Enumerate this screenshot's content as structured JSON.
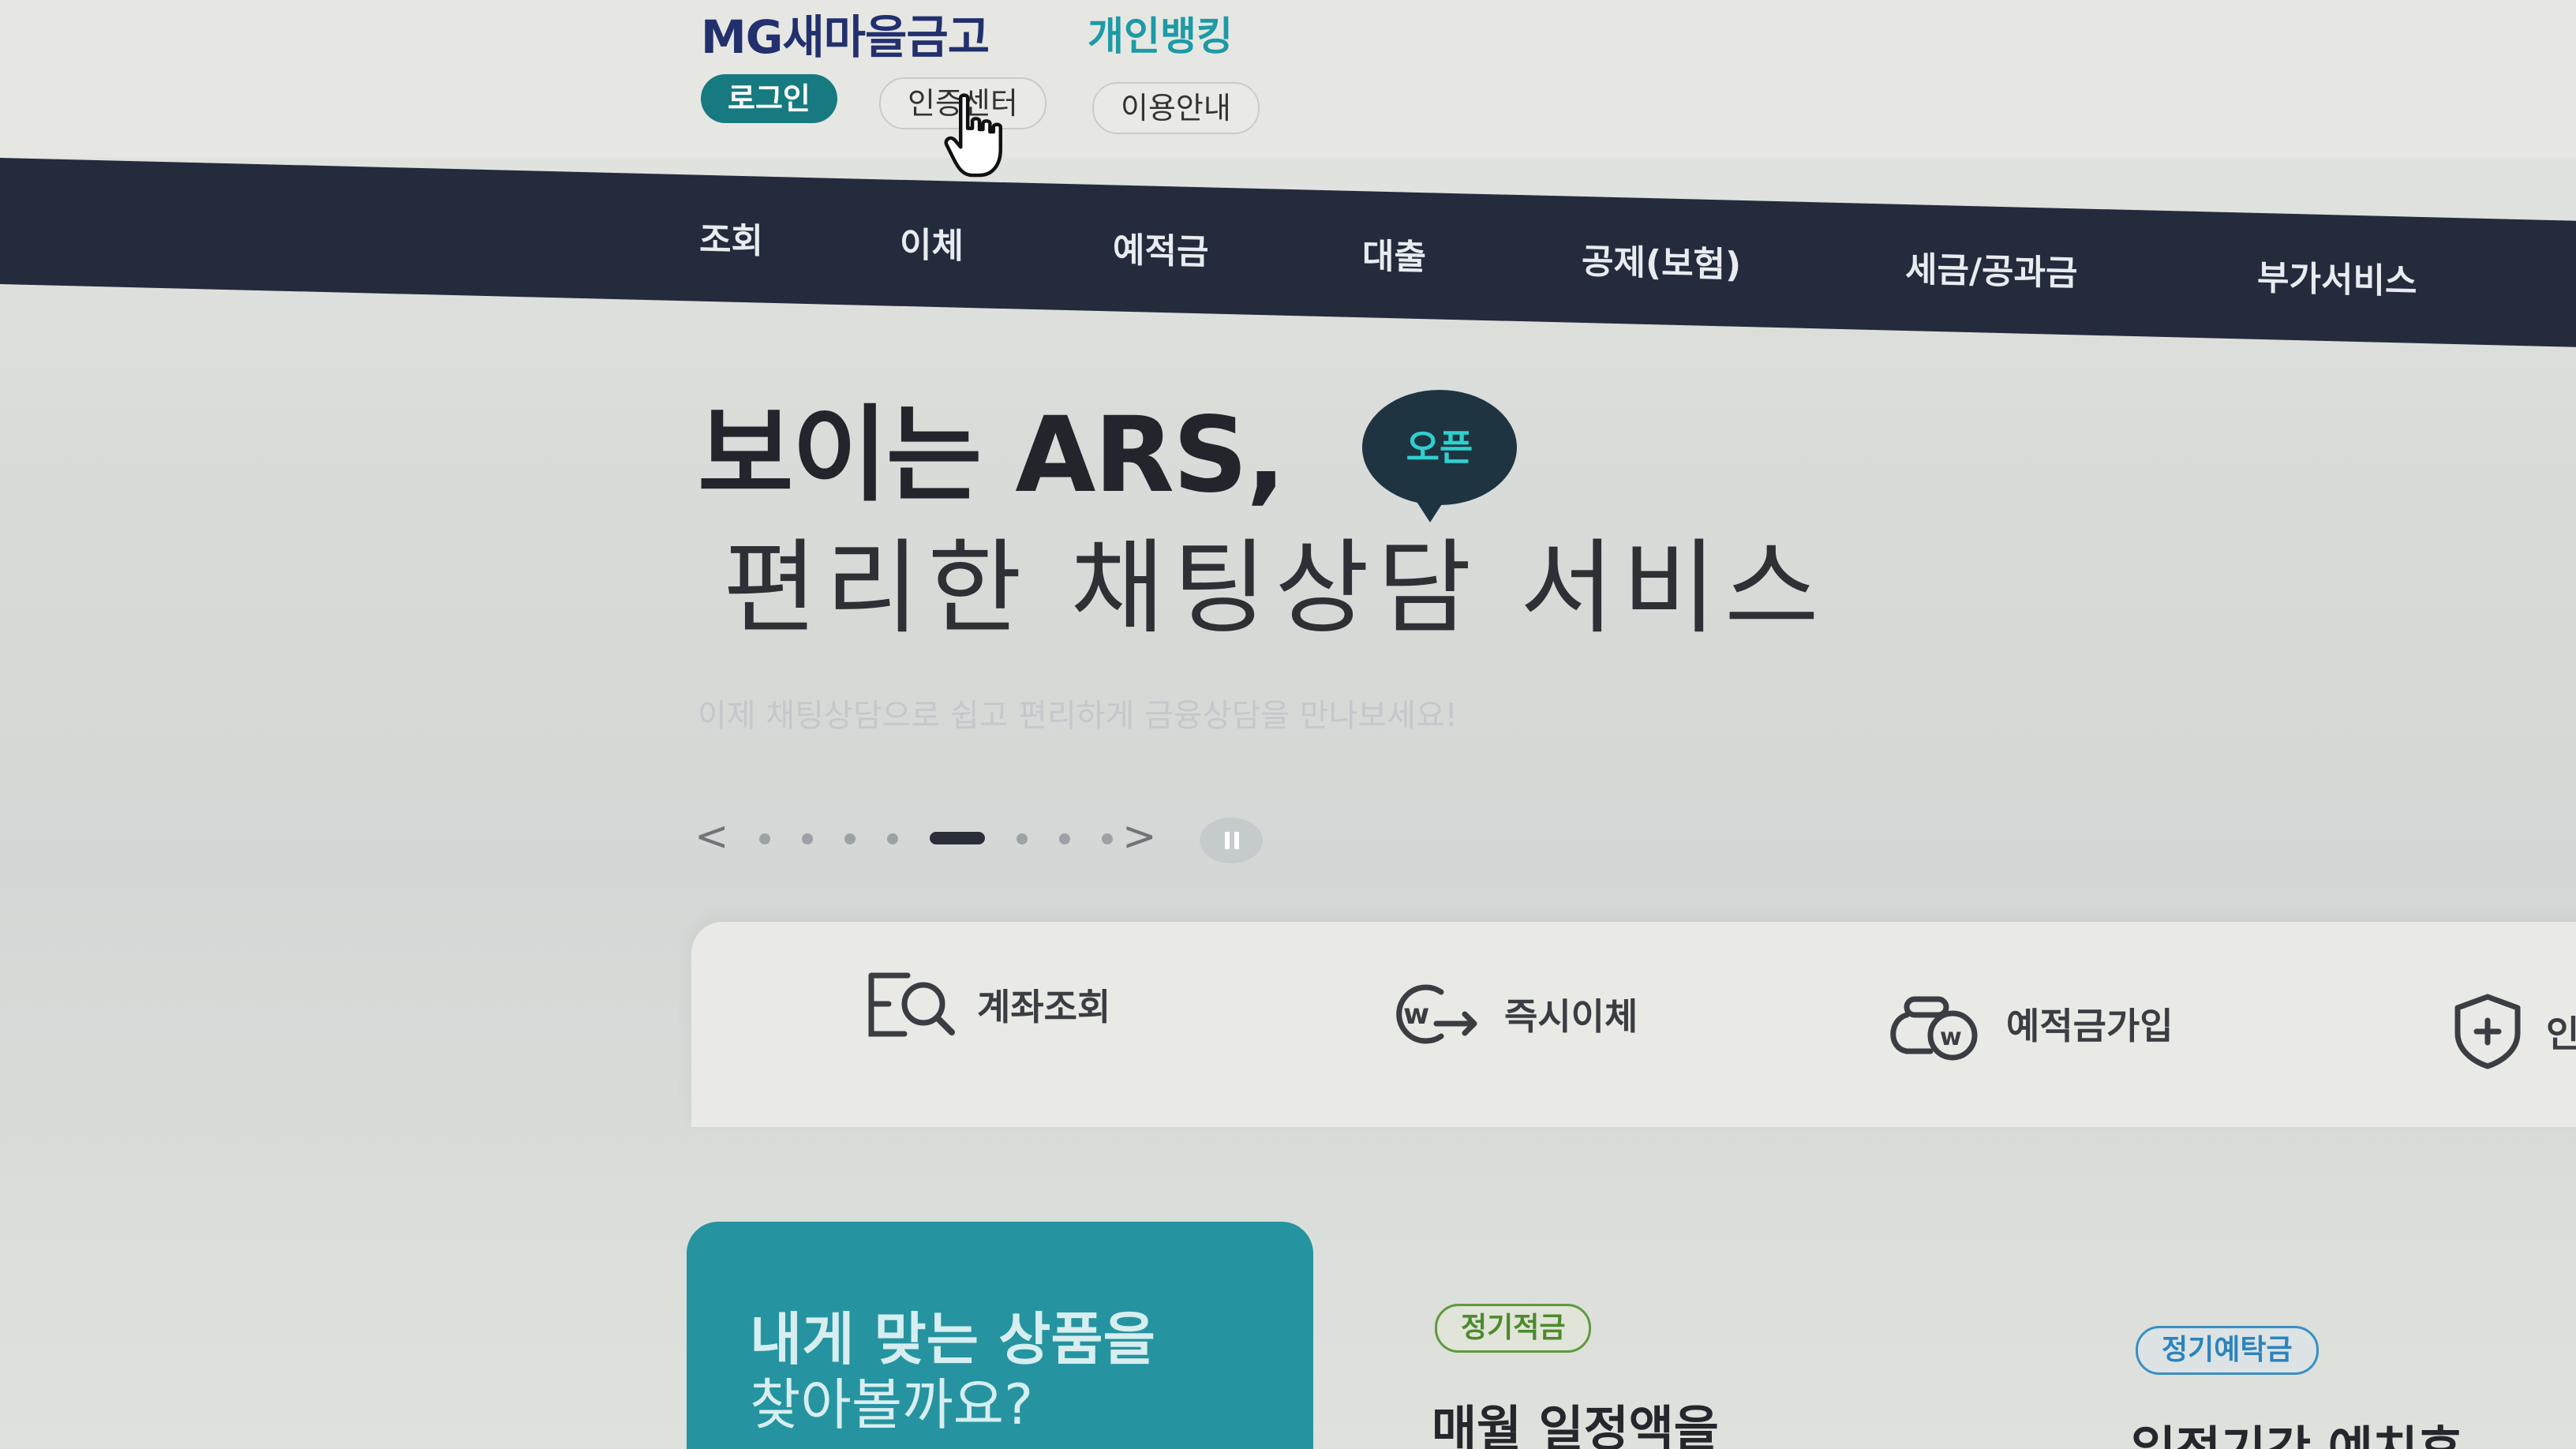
{
  "header": {
    "logo": "MG새마을금고",
    "section": "개인뱅킹",
    "util_menu": {
      "login": "로그인",
      "cert_center": "인증센터",
      "guide": "이용안내"
    }
  },
  "gnb": {
    "items": [
      "조회",
      "이체",
      "예적금",
      "대출",
      "공제(보험)",
      "세금/공과금",
      "부가서비스"
    ]
  },
  "hero": {
    "title_line1": "보이는 ARS,",
    "badge": "오픈",
    "title_line2": "편리한 채팅상담 서비스",
    "description": "이제 채팅상담으로 쉽고 편리하게 금융상담을 만나보세요!"
  },
  "slider": {
    "prev_label": "<",
    "next_label": ">",
    "total_slides": 8,
    "active_slide": 5
  },
  "quick_menu": {
    "items": [
      {
        "label": "계좌조회",
        "icon": "account-search-icon"
      },
      {
        "label": "즉시이체",
        "icon": "instant-transfer-icon"
      },
      {
        "label": "예적금가입",
        "icon": "savings-join-icon"
      },
      {
        "label": "인",
        "icon": "shield-plus-icon"
      }
    ]
  },
  "products": {
    "promo_line1": "내게 맞는 상품을",
    "promo_line2": "찾아볼까요?",
    "cards": [
      {
        "tag": "정기적금",
        "title": "매월 일정액을"
      },
      {
        "tag": "정기예탁금",
        "title": "일정기간 예치후"
      }
    ]
  },
  "colors": {
    "brand_navy": "#22306e",
    "brand_teal": "#1d9aa6",
    "gnb_bg": "#232b3c",
    "promo_card": "#2594a0"
  }
}
